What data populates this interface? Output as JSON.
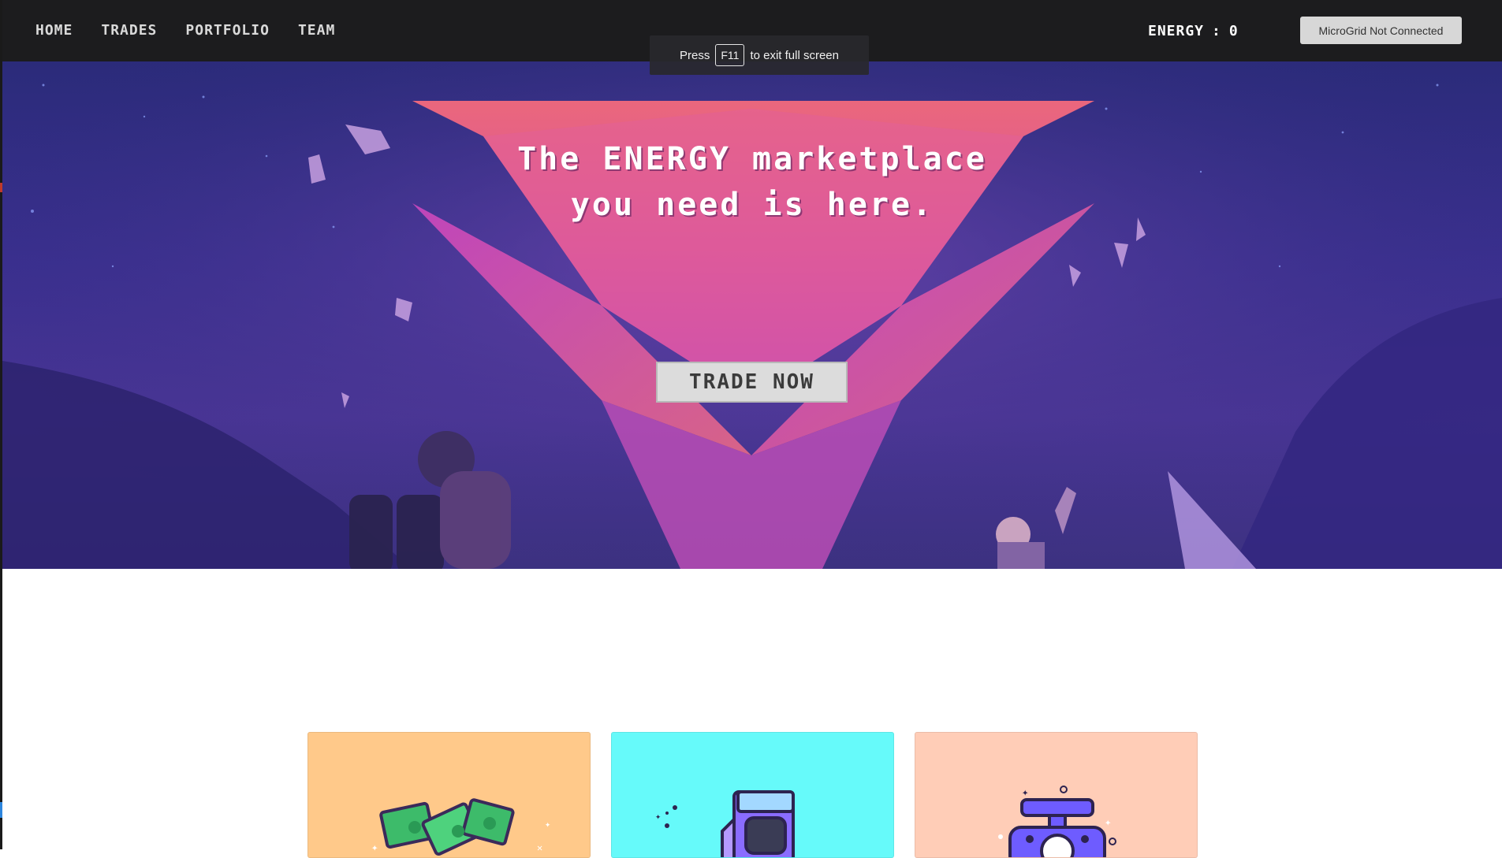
{
  "nav": {
    "links": [
      "HOME",
      "TRADES",
      "PORTFOLIO",
      "TEAM"
    ],
    "energy_label": "ENERGY",
    "energy_separator": ":",
    "energy_value": "0",
    "microgrid_button": "MicroGrid Not Connected"
  },
  "fullscreen_toast": {
    "press": "Press",
    "key": "F11",
    "suffix": "to exit full screen"
  },
  "hero": {
    "title_line1": "The ENERGY marketplace",
    "title_line2": "you need is here.",
    "cta": "TRADE NOW"
  },
  "cards": [
    {
      "color": "#ffc98a",
      "icon": "money-stack-icon"
    },
    {
      "color": "#66fafa",
      "icon": "arcade-machine-icon"
    },
    {
      "color": "#ffcdb7",
      "icon": "weighing-scale-icon"
    }
  ],
  "colors": {
    "navbar": "#1c1c1e",
    "crystal_pink": "#f0707a",
    "crystal_magenta": "#c93ec7",
    "hero_purple": "#3a2f8f"
  }
}
